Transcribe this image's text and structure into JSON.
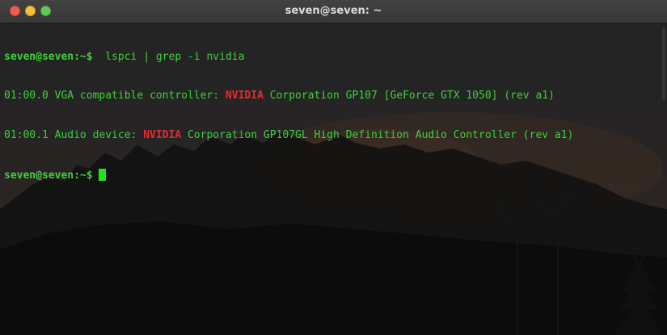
{
  "window": {
    "title": "seven@seven: ~",
    "colors": {
      "close": "#ed5f52",
      "minimize": "#f8bd3a",
      "maximize": "#62c654",
      "text": "#3fd03b",
      "match": "#e82b2b",
      "cursor": "#24e024"
    }
  },
  "terminal": {
    "prompt1": {
      "user_host": "seven@seven",
      "path_sep": ":~$",
      "command": "  lspci | grep -i nvidia"
    },
    "output": [
      {
        "before": "01:00.0 VGA compatible controller: ",
        "match": "NVIDIA",
        "after": " Corporation GP107 [GeForce GTX 1050] (rev a1)"
      },
      {
        "before": "01:00.1 Audio device: ",
        "match": "NVIDIA",
        "after": " Corporation GP107GL High Definition Audio Controller (rev a1)"
      }
    ],
    "prompt2": {
      "user_host": "seven@seven",
      "path_sep": ":~$",
      "command": " "
    }
  }
}
